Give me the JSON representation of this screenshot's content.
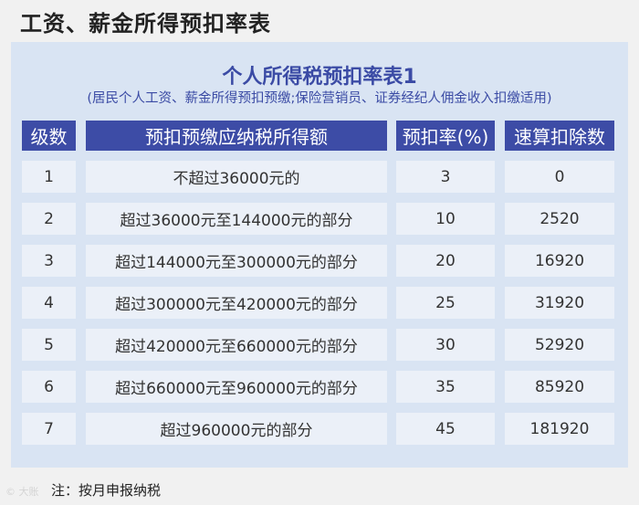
{
  "page_heading": "工资、薪金所得预扣率表",
  "table": {
    "title": "个人所得税预扣率表1",
    "subtitle": "(居民个人工资、薪金所得预扣预缴;保险营销员、证券经纪人佣金收入扣缴适用)",
    "headers": [
      "级数",
      "预扣预缴应纳税所得额",
      "预扣率(%)",
      "速算扣除数"
    ],
    "rows": [
      [
        "1",
        "不超过36000元的",
        "3",
        "0"
      ],
      [
        "2",
        "超过36000元至144000元的部分",
        "10",
        "2520"
      ],
      [
        "3",
        "超过144000元至300000元的部分",
        "20",
        "16920"
      ],
      [
        "4",
        "超过300000元至420000元的部分",
        "25",
        "31920"
      ],
      [
        "5",
        "超过420000元至660000元的部分",
        "30",
        "52920"
      ],
      [
        "6",
        "超过660000元至960000元的部分",
        "35",
        "85920"
      ],
      [
        "7",
        "超过960000元的部分",
        "45",
        "181920"
      ]
    ]
  },
  "footnote": "注：按月申报纳税",
  "watermark": "© 大账"
}
